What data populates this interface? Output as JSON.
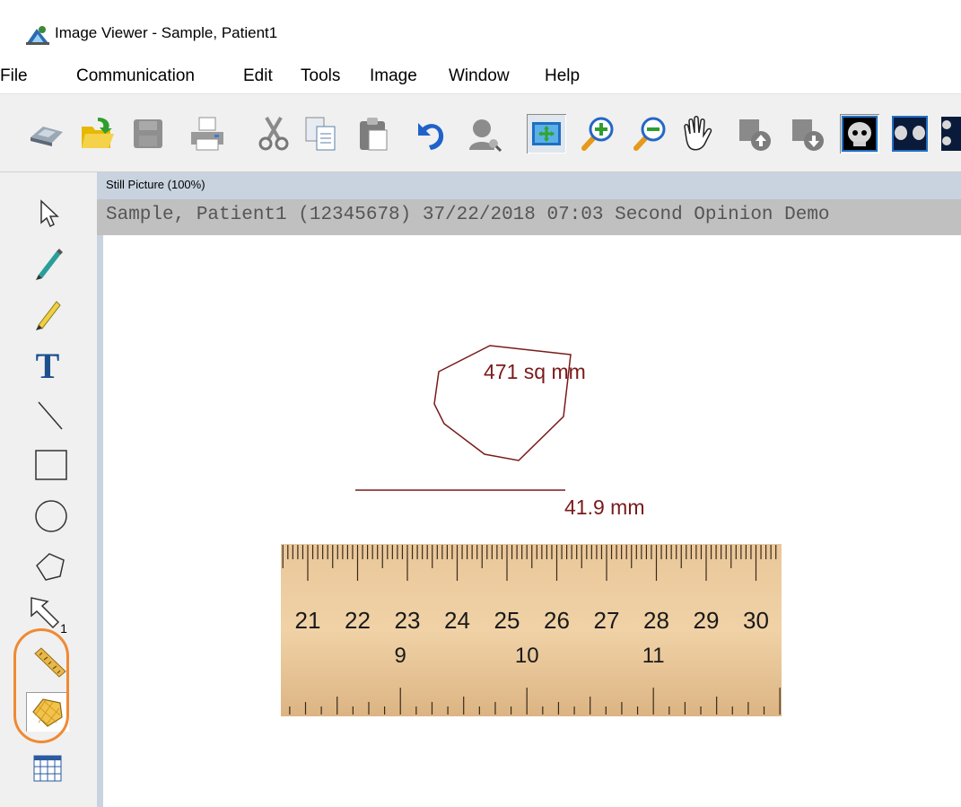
{
  "window": {
    "title": "Image Viewer - Sample, Patient1",
    "app_icon": "image-viewer-icon"
  },
  "menubar": {
    "items": [
      "File",
      "Communication",
      "Edit",
      "Tools",
      "Image",
      "Window",
      "Help"
    ]
  },
  "toolbar": {
    "buttons": [
      {
        "icon": "scanner-icon"
      },
      {
        "icon": "open-folder-icon"
      },
      {
        "icon": "save-disabled-icon"
      },
      {
        "icon": "print-icon"
      },
      {
        "icon": "cut-icon"
      },
      {
        "icon": "copy-icon"
      },
      {
        "icon": "paste-icon"
      },
      {
        "icon": "undo-icon"
      },
      {
        "icon": "patient-search-icon"
      },
      {
        "icon": "fit-window-icon",
        "pressed": true
      },
      {
        "icon": "zoom-in-icon"
      },
      {
        "icon": "zoom-out-icon"
      },
      {
        "icon": "pan-hand-icon"
      },
      {
        "icon": "move-up-icon"
      },
      {
        "icon": "move-down-icon"
      },
      {
        "icon": "single-view-icon",
        "pressed": true
      },
      {
        "icon": "dual-view-icon"
      },
      {
        "icon": "quad-view-icon"
      }
    ]
  },
  "tools": {
    "items": [
      {
        "icon": "select-arrow-icon"
      },
      {
        "icon": "pen-icon"
      },
      {
        "icon": "highlighter-icon"
      },
      {
        "icon": "text-icon",
        "glyph": "T"
      },
      {
        "icon": "line-icon"
      },
      {
        "icon": "rectangle-icon"
      },
      {
        "icon": "ellipse-icon"
      },
      {
        "icon": "polygon-icon"
      },
      {
        "icon": "arrow-icon",
        "glyph": "1"
      },
      {
        "icon": "ruler-icon"
      },
      {
        "icon": "area-measure-icon",
        "pressed": true
      },
      {
        "icon": "grid-icon"
      }
    ],
    "highlight_color": "#ef8a33"
  },
  "viewer": {
    "child_title": "Still Picture (100%)",
    "overlay_text": "Sample, Patient1 (12345678) 37/22/2018 07:03 Second Opinion Demo",
    "annotation_color": "#7a1a1a",
    "area_label": "471 sq mm",
    "length_label": "41.9 mm",
    "ruler": {
      "cm_labels": [
        "21",
        "22",
        "23",
        "24",
        "25",
        "26",
        "27",
        "28",
        "29",
        "30"
      ],
      "inch_labels": [
        "9",
        "10",
        "11"
      ]
    }
  }
}
